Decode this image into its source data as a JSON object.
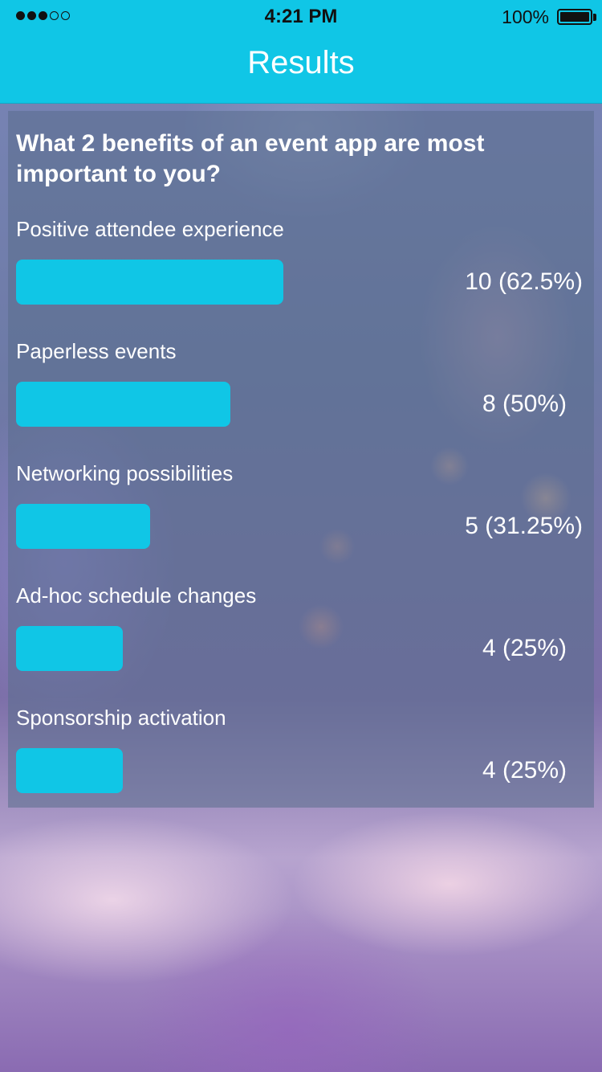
{
  "status_bar": {
    "time": "4:21 PM",
    "battery_percent": "100%",
    "signal_bars_filled": 3,
    "signal_bars_total": 5
  },
  "nav": {
    "title": "Results"
  },
  "poll": {
    "question": "What 2 benefits of an event app are most important to you?",
    "bar_color": "#10c6e6",
    "options": [
      {
        "label": "Positive attendee experience",
        "result": "10 (62.5%)",
        "percent": 62.5
      },
      {
        "label": "Paperless events",
        "result": "8 (50%)",
        "percent": 50
      },
      {
        "label": "Networking possibilities",
        "result": "5 (31.25%)",
        "percent": 31.25
      },
      {
        "label": "Ad-hoc schedule changes",
        "result": "4 (25%)",
        "percent": 25
      },
      {
        "label": "Sponsorship activation",
        "result": "4 (25%)",
        "percent": 25
      }
    ]
  }
}
